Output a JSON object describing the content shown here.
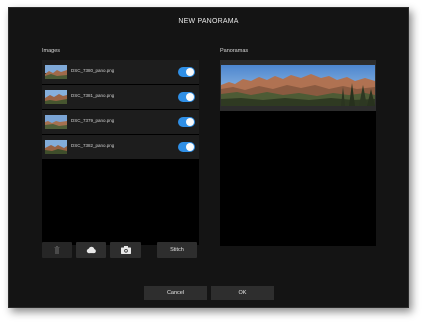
{
  "dialog": {
    "title": "NEW PANORAMA"
  },
  "images_section": {
    "label": "Images",
    "items": [
      {
        "file": "DSC_7380_pano.png",
        "enabled": true
      },
      {
        "file": "DSC_7381_pano.png",
        "enabled": true
      },
      {
        "file": "DSC_7379_pano.png",
        "enabled": true
      },
      {
        "file": "DSC_7382_pano.png",
        "enabled": true
      }
    ]
  },
  "toolbar": {
    "delete_icon": "trash-icon",
    "cloud_icon": "cloud-icon",
    "camera_icon": "camera-icon",
    "stitch_label": "Stitch"
  },
  "panoramas_section": {
    "label": "Panoramas"
  },
  "footer": {
    "cancel_label": "Cancel",
    "ok_label": "OK"
  },
  "colors": {
    "accent": "#2f8fe6",
    "background": "#141414",
    "button": "#2e2e2e"
  }
}
